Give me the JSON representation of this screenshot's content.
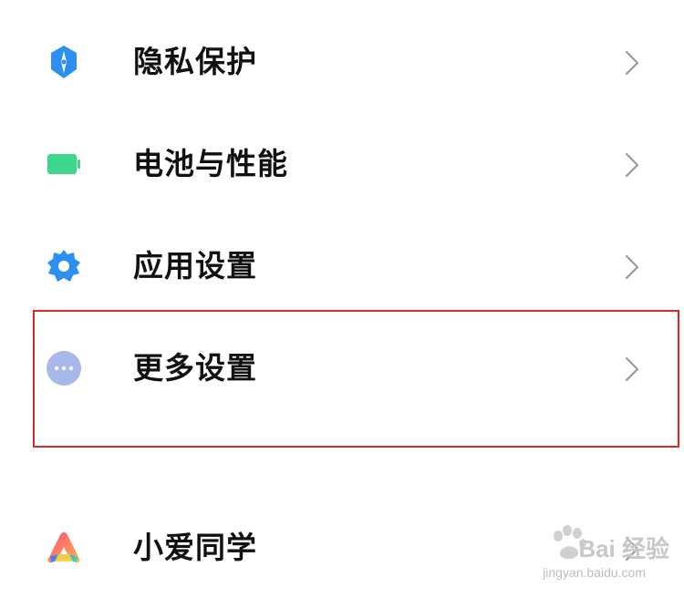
{
  "settings": {
    "items": [
      {
        "label": "隐私保护",
        "icon": "shield-icon",
        "icon_color": "#2d8ff0"
      },
      {
        "label": "电池与性能",
        "icon": "battery-icon",
        "icon_color": "#3dd68c"
      },
      {
        "label": "应用设置",
        "icon": "gear-icon",
        "icon_color": "#2d8ff0"
      },
      {
        "label": "更多设置",
        "icon": "more-dots-icon",
        "icon_color": "#a8b8e8"
      },
      {
        "label": "小爱同学",
        "icon": "xiaoai-icon",
        "icon_color": "#ff5a7a"
      }
    ]
  },
  "highlight": {
    "color": "#d8272d"
  },
  "watermark": {
    "text": "Bai 经验",
    "sub": "jingyan.baidu.com"
  }
}
